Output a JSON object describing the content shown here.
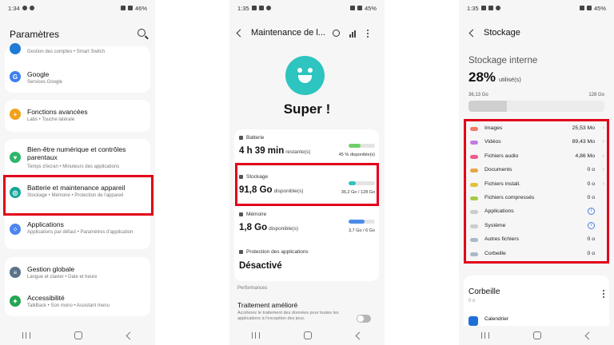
{
  "phone1": {
    "status": {
      "time": "1:34",
      "battery": "46%"
    },
    "title": "Paramètres",
    "items": [
      {
        "title": "",
        "sub": "Gestion des comptes  •  Smart Switch",
        "color": "#1e7bd6"
      },
      {
        "title": "Google",
        "sub": "Services Google",
        "color": "#3d7ff0"
      },
      {
        "title": "Fonctions avancées",
        "sub": "Labs  •  Touche latérale",
        "color": "#f0a21c"
      },
      {
        "title": "Bien-être numérique et contrôles parentaux",
        "sub": "Temps d'écran  •  Minuteurs des applications",
        "color": "#2eb66a"
      },
      {
        "title": "Batterie et maintenance appareil",
        "sub": "Stockage  •  Mémoire  •  Protection de l'appareil",
        "color": "#16a59a"
      },
      {
        "title": "Applications",
        "sub": "Applications par défaut  •  Paramètres d'application",
        "color": "#4e86f0"
      },
      {
        "title": "Gestion globale",
        "sub": "Langue et clavier  •  Date et heure",
        "color": "#5b7389"
      },
      {
        "title": "Accessibilité",
        "sub": "TalkBack  •  Son mono  •  Assistant menu",
        "color": "#22a552"
      }
    ]
  },
  "phone2": {
    "status": {
      "time": "1:35",
      "battery": "45%"
    },
    "title": "Maintenance de l...",
    "status_text": "Super !",
    "battery": {
      "label": "Batterie",
      "value": "4 h 39 min",
      "unit": "restante(s)",
      "note": "45 % disponible(s)",
      "level": 0.45,
      "color": "#6fcf6a"
    },
    "storage": {
      "label": "Stockage",
      "value": "91,8 Go",
      "unit": "disponible(s)",
      "note": "36,2 Go / 128 Go",
      "level": 0.28,
      "color": "#2ec4c0"
    },
    "memory": {
      "label": "Mémoire",
      "value": "1,8 Go",
      "unit": "disponible(s)",
      "note": "3,7 Go / 6 Go",
      "level": 0.62,
      "color": "#4a8be8"
    },
    "protection": {
      "label": "Protection des applications",
      "value": "Désactivé"
    },
    "performance_header": "Performances",
    "treatment": {
      "title": "Traitement amélioré",
      "sub": "Accélerez le traitement des données pour toutes les applications à l'exception des jeux."
    }
  },
  "phone3": {
    "status": {
      "time": "1:35",
      "battery": "45%"
    },
    "title": "Stockage",
    "internal_title": "Stockage interne",
    "percent": "28%",
    "percent_unit": "utilisé(s)",
    "used": "36,13 Go",
    "total": "128 Go",
    "used_fraction": 0.28,
    "categories": [
      {
        "name": "Images",
        "value": "25,53 Mo",
        "color": "#f07a6a",
        "chev": true
      },
      {
        "name": "Vidéos",
        "value": "89,43 Mo",
        "color": "#c37ae0",
        "chev": true
      },
      {
        "name": "Fichiers audio",
        "value": "4,86 Mo",
        "color": "#ef5a8a",
        "chev": true
      },
      {
        "name": "Documents",
        "value": "0 o",
        "color": "#e7a54a",
        "chev": true
      },
      {
        "name": "Fichiers install.",
        "value": "0 o",
        "color": "#e0c23a",
        "chev": true
      },
      {
        "name": "Fichiers compressés",
        "value": "0 o",
        "color": "#a8c84a",
        "chev": false
      },
      {
        "name": "Applications",
        "value": "",
        "color": "#cccccc",
        "info": true
      },
      {
        "name": "Système",
        "value": "",
        "color": "#cccccc",
        "info": true
      },
      {
        "name": "Autres fichiers",
        "value": "0 o",
        "color": "#a9b9c9",
        "chev": false
      },
      {
        "name": "Corbeille",
        "value": "0 o",
        "color": "#a9b9c9",
        "chev": false
      }
    ],
    "bin": {
      "title": "Corbeille",
      "size": "0 o",
      "app": "Calendrier"
    }
  }
}
